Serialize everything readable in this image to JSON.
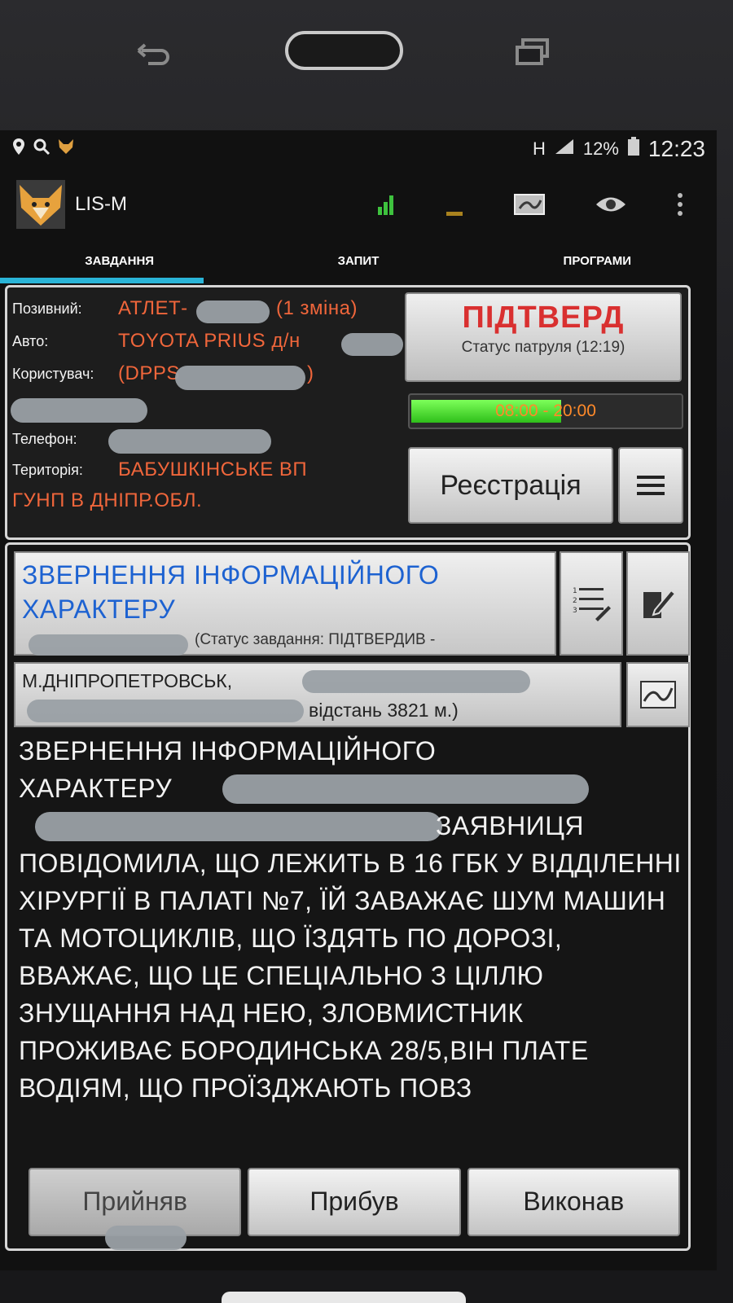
{
  "status_bar": {
    "battery": "12%",
    "time": "12:23",
    "network": "H"
  },
  "app": {
    "title": "LIS-M"
  },
  "tabs": [
    {
      "label": "ЗАВДАННЯ",
      "active": true
    },
    {
      "label": "ЗАПИТ",
      "active": false
    },
    {
      "label": "ПРОГРАМИ",
      "active": false
    }
  ],
  "patrol": {
    "callsign_label": "Позивний:",
    "callsign_value": "АТЛЕТ-",
    "callsign_shift": "(1 зміна)",
    "car_label": "Авто:",
    "car_value": "TOYOTA PRIUS д/н",
    "user_label": "Користувач:",
    "user_value_open": "(DPPS",
    "user_value_close": ")",
    "phone_label": "Телефон:",
    "territory_label": "Територія:",
    "territory_line1": "БАБУШКІНСЬКЕ ВП",
    "territory_line2": "ГУНП В ДНІПР.ОБЛ.",
    "confirm_title": "ПІДТВЕРД",
    "confirm_subtitle": "Статус патруля (12:19)",
    "shift_time": "08:00 - 20:00",
    "shift_progress": 0.55,
    "register_label": "Реєстрація"
  },
  "task": {
    "title": "ЗВЕРНЕННЯ ІНФОРМАЦІЙНОГО ХАРАКТЕРУ",
    "status_text": "(Статус завдання: ПІДТВЕРДИВ -",
    "address_line1": "М.ДНІПРОПЕТРОВСЬК,",
    "address_line2": "відстань 3821 м.)",
    "description_line1": "ЗВЕРНЕННЯ ІНФОРМАЦІЙНОГО",
    "description_line2": "ХАРАКТЕРУ",
    "description_line3": "ЗАЯВНИЦЯ",
    "description_rest": "ПОВІДОМИЛА, ЩО ЛЕЖИТЬ В 16 ГБК У ВІДДІЛЕННІ ХІРУРГІЇ В ПАЛАТІ №7, ЇЙ ЗАВАЖАЄ ШУМ МАШИН ТА МОТОЦИКЛІВ, ЩО ЇЗДЯТЬ ПО ДОРОЗІ, ВВАЖАЄ, ЩО ЦЕ СПЕЦІАЛЬНО З ЦІЛЛЮ ЗНУЩАННЯ НАД НЕЮ, ЗЛОВМИСТНИК ПРОЖИВАЄ БОРОДИНСЬКА 28/5,ВІН ПЛАТЕ ВОДІЯМ, ЩО ПРОЇЗДЖАЮТЬ ПОВЗ"
  },
  "actions": {
    "accepted": "Прийняв",
    "arrived": "Прибув",
    "done": "Виконав"
  },
  "colors": {
    "accent_tab": "#2ab4d7",
    "value_text": "#f0663b",
    "confirm": "#d93030",
    "task_title": "#1d62d1"
  }
}
